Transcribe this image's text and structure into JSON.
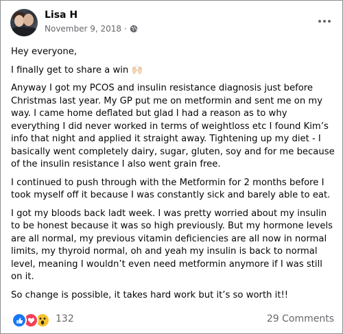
{
  "post": {
    "author": "Lisa H",
    "date": "November 9, 2018",
    "separator": "·",
    "privacy_icon": "globe-icon",
    "menu_icon": "more-horizontal-icon",
    "paragraphs": [
      "Hey everyone,",
      "I finally get to share a win 🙌🏻",
      "Anyway I got my PCOS and insulin resistance diagnosis just before Christmas last year. My GP put me on metformin and sent me on my way. I came home deflated but glad I had a reason as to why everything I did never worked in terms of weightloss etc I found Kim’s info that night and applied it straight away. Tightening up my diet - I basically went completely dairy, sugar, gluten, soy and for me because of the insulin resistance I also went grain free.",
      "I continued to push through with the Metformin for 2 months before I took myself off it because I was constantly sick and barely able to eat.",
      "I got my bloods back ladt week. I was pretty worried about my insulin to be honest because it was so high previously. But my hormone levels are all normal, my previous vitamin deficiencies are all now in normal limits, my thyroid normal, oh and yeah my insulin is back to normal level, meaning I wouldn’t even need metformin anymore if I was still on it.",
      "So change is possible, it takes hard work but it’s so worth it!!"
    ]
  },
  "footer": {
    "reactions": [
      "like-icon",
      "love-icon",
      "wow-icon"
    ],
    "reaction_count": "132",
    "comments": "29 Comments"
  },
  "colors": {
    "like": "#1877f2",
    "love": "#f33e58",
    "wow": "#f7c22f",
    "muted": "#65676b"
  }
}
